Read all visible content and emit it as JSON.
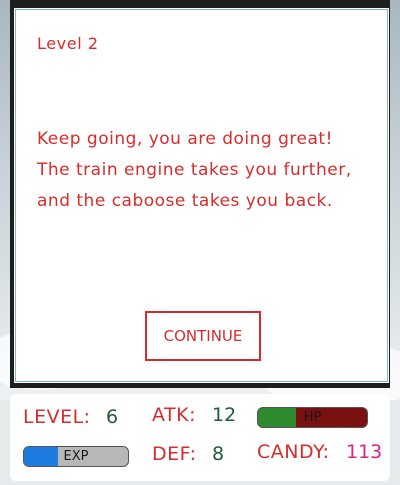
{
  "dialog": {
    "level_title": "Level 2",
    "message": "Keep going, you are doing great! The train engine takes you further, and the caboose takes you back.",
    "continue_label": "CONTINUE"
  },
  "hud": {
    "level_label": "LEVEL:",
    "level_value": "6",
    "atk_label": "ATK:",
    "atk_value": "12",
    "def_label": "DEF:",
    "def_value": "8",
    "candy_label": "CANDY:",
    "candy_value": "113",
    "hp_label": "HP",
    "hp_fraction": 0.35,
    "exp_label": "EXP",
    "exp_fraction": 0.33
  },
  "colors": {
    "accent_red": "#d92b2b",
    "value_green": "#1f5a3a",
    "candy_pink": "#e0208a",
    "hp_fill": "#2e8b2e",
    "hp_empty": "#7a1010",
    "exp_fill": "#1e7be0",
    "exp_empty": "#b8b8b8"
  }
}
